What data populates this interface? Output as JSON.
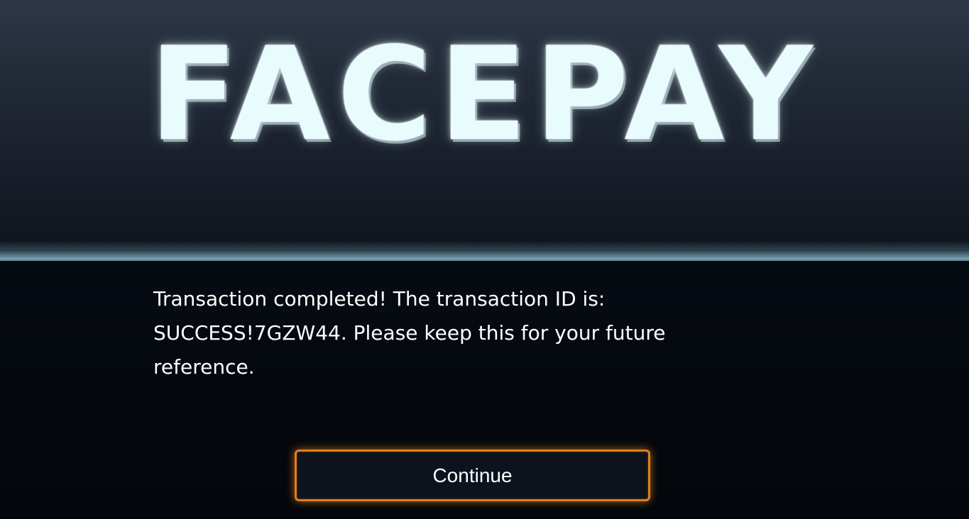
{
  "app": {
    "logo_text": "FACEPAY"
  },
  "main": {
    "message": "Transaction completed! The transaction ID is: SUCCESS!7GZW44. Please keep this for your future reference.",
    "continue_label": "Continue"
  },
  "colors": {
    "logo_text": "#e8fbfd",
    "button_border": "#e07f1c",
    "background": "#04080e",
    "header_top": "#2e3747"
  }
}
